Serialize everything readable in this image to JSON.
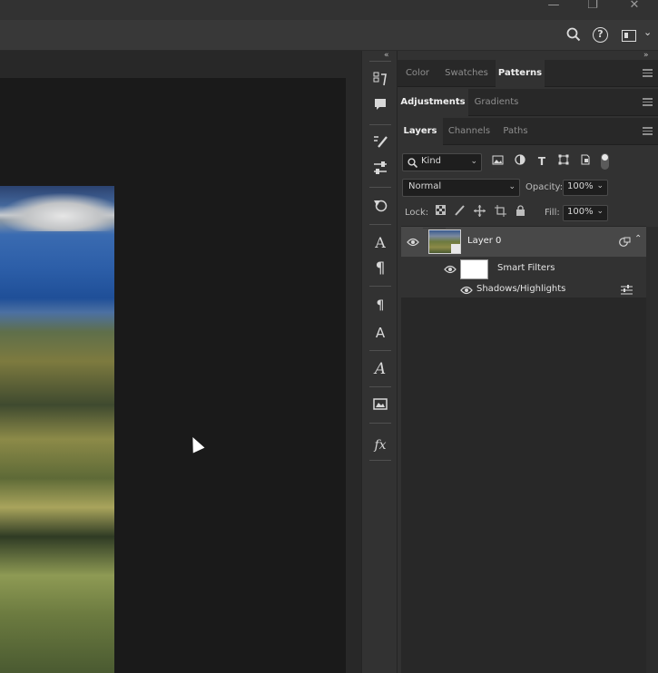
{
  "window": {
    "controls": [
      {
        "name": "minimize",
        "glyph": "—"
      },
      {
        "name": "restore",
        "glyph": "❐"
      },
      {
        "name": "close",
        "glyph": "✕"
      }
    ]
  },
  "options_bar": {
    "icons": [
      "search-icon",
      "help-icon",
      "workspace-icon"
    ],
    "help_glyph": "?",
    "workspace_chevron": "⌄"
  },
  "panel_groups": {
    "collapse_left": "«",
    "collapse_right": "»",
    "group1_tabs": [
      {
        "label": "Color",
        "active": false
      },
      {
        "label": "Swatches",
        "active": false
      },
      {
        "label": "Patterns",
        "active": true
      }
    ],
    "group2_tabs": [
      {
        "label": "Adjustments",
        "active": true
      },
      {
        "label": "Gradients",
        "active": false
      }
    ],
    "group3_tabs": [
      {
        "label": "Layers",
        "active": true
      },
      {
        "label": "Channels",
        "active": false
      },
      {
        "label": "Paths",
        "active": false
      }
    ]
  },
  "layers_panel": {
    "filter_kind": "Kind",
    "blend_mode": "Normal",
    "opacity_label": "Opacity:",
    "opacity_value": "100%",
    "lock_label": "Lock:",
    "fill_label": "Fill:",
    "fill_value": "100%",
    "layers": [
      {
        "name": "Layer 0",
        "type": "smart-object",
        "visible": true,
        "selected": true
      },
      {
        "name": "Smart Filters",
        "type": "smart-filters",
        "visible": true
      },
      {
        "name": "Shadows/Highlights",
        "type": "filter",
        "visible": true
      }
    ]
  },
  "toolstrip": {
    "icons": [
      "history-icon",
      "comment-icon",
      "brush-settings-icon",
      "properties-icon",
      "adjust-shape-icon",
      "character-icon",
      "paragraph-icon",
      "paragraph-styles-icon",
      "character-styles-icon",
      "glyphs-icon",
      "libraries-icon",
      "styles-fx-icon"
    ]
  },
  "colors": {
    "bg": "#1e1e1e",
    "panel": "#323232",
    "selected_row": "#484848",
    "text": "#d4d4d4"
  }
}
